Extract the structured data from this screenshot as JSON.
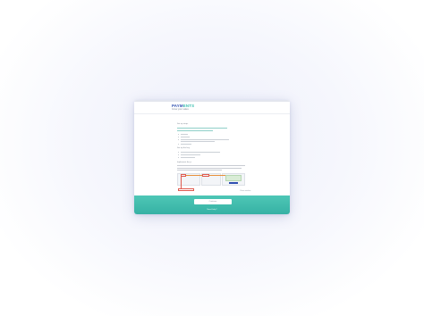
{
  "brand": {
    "name_left": "PAYM",
    "name_right": "ENTS",
    "tagline": "Grow your sales"
  },
  "sections": [
    {
      "heading": "Set up steps"
    },
    {
      "heading": "Set up the key"
    },
    {
      "heading": "Implement the js"
    }
  ],
  "links": {
    "close": "Close window",
    "footer": "Need help?"
  },
  "footer": {
    "button_label": "Continue"
  },
  "colors": {
    "accent": "#2aa8a0",
    "brand": "#2f4fb0",
    "footer": "#3fbcad",
    "highlight": "#e05a4f"
  }
}
